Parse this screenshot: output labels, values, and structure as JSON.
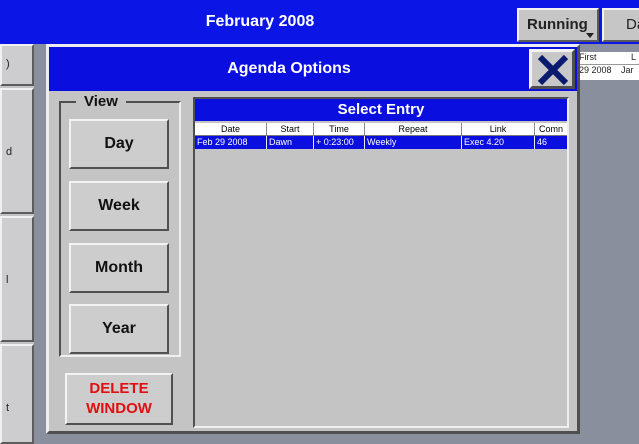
{
  "app": {
    "month_title": "February 2008",
    "running_label": "Running",
    "date_label": "Da"
  },
  "left_strip": {
    "items": [
      {
        "label": ")"
      },
      {
        "label": "d"
      },
      {
        "label": "l"
      },
      {
        "label": "t"
      }
    ]
  },
  "background_table": {
    "headers": [
      "First",
      "L"
    ],
    "row": [
      "29 2008",
      "Jar"
    ]
  },
  "dialog": {
    "title": "Agenda Options",
    "close_icon": "close-x-icon",
    "view_group": {
      "legend": "View",
      "buttons": [
        "Day",
        "Week",
        "Month",
        "Year"
      ]
    },
    "delete_button": {
      "line1": "DELETE",
      "line2": "WINDOW",
      "color": "#e01010"
    },
    "entry_panel": {
      "title": "Select Entry",
      "columns": [
        "Date",
        "Start",
        "Time",
        "Repeat",
        "Link",
        "Comn"
      ],
      "rows": [
        [
          "Feb 29 2008",
          "Dawn",
          "+ 0:23:00",
          "Weekly",
          "Exec 4.20",
          "46"
        ]
      ]
    }
  },
  "colors": {
    "title_blue": "#0a0fdf",
    "panel_gray": "#c4c4c4",
    "delete_red": "#e01010"
  }
}
